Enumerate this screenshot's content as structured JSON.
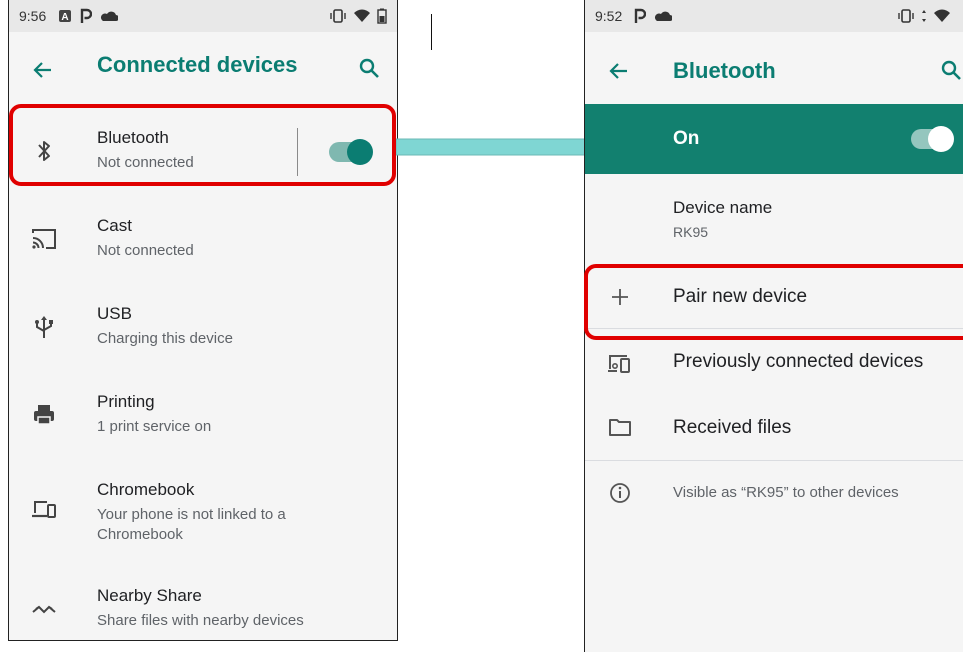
{
  "left_phone": {
    "status": {
      "time": "9:56"
    },
    "toolbar": {
      "title": "Connected devices"
    },
    "items": [
      {
        "title": "Bluetooth",
        "subtitle": "Not connected",
        "icon": "bluetooth-icon"
      },
      {
        "title": "Cast",
        "subtitle": "Not connected",
        "icon": "cast-icon"
      },
      {
        "title": "USB",
        "subtitle": "Charging this device",
        "icon": "usb-icon"
      },
      {
        "title": "Printing",
        "subtitle": "1 print service on",
        "icon": "printer-icon"
      },
      {
        "title": "Chromebook",
        "subtitle": "Your phone is not linked to a Chromebook",
        "icon": "chromebook-icon"
      },
      {
        "title": "Nearby Share",
        "subtitle": "Share files with nearby devices",
        "icon": "nearby-share-icon"
      }
    ],
    "bluetooth_toggle_on": true
  },
  "right_phone": {
    "status": {
      "time": "9:52"
    },
    "toolbar": {
      "title": "Bluetooth"
    },
    "master_switch": {
      "label": "On",
      "on": true
    },
    "device_name": {
      "title": "Device name",
      "value": "RK95"
    },
    "items": [
      {
        "label": "Pair new device",
        "icon": "plus-icon"
      },
      {
        "label": "Previously connected devices",
        "icon": "devices-icon"
      },
      {
        "label": "Received files",
        "icon": "folder-icon"
      }
    ],
    "footer_note": "Visible as “RK95” to other devices"
  },
  "colors": {
    "accent": "#0b7d72",
    "switch_bar": "#12806f",
    "highlight": "#e00000",
    "arrow": "#7fd6d3"
  }
}
